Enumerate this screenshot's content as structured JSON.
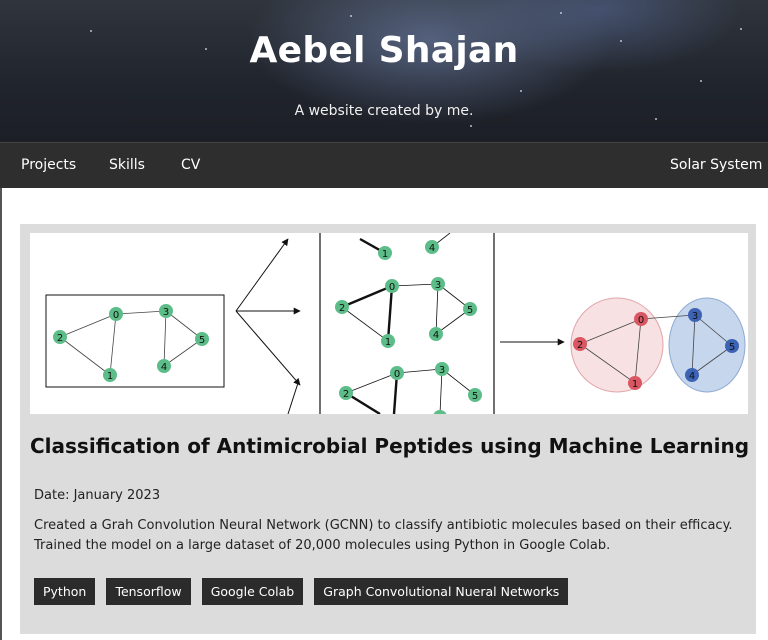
{
  "site": {
    "title": "Aebel Shajan",
    "subtitle": "A website created by me."
  },
  "nav": {
    "items": [
      "Projects",
      "Skills",
      "CV"
    ],
    "right_item": "Solar System"
  },
  "project": {
    "title": "Classification of Antimicrobial Peptides using Machine Learning",
    "date": "Date: January 2023",
    "description": "Created a Grah Convolution Neural Network (GCNN) to classify antibiotic molecules based on their efficacy. Trained the model on a large dataset of 20,000 molecules using Python in Google Colab.",
    "tags": [
      "Python",
      "Tensorflow",
      "Google Colab",
      "Graph Convolutional Nueral Networks"
    ]
  },
  "figure": {
    "node_labels": [
      "0",
      "1",
      "2",
      "3",
      "4",
      "5"
    ],
    "colors": {
      "node_green": "#5cbd89",
      "node_red": "#d95762",
      "node_blue": "#3d63b5",
      "cluster_red": "#f6d4d6",
      "cluster_blue": "#bfd1ea"
    }
  }
}
